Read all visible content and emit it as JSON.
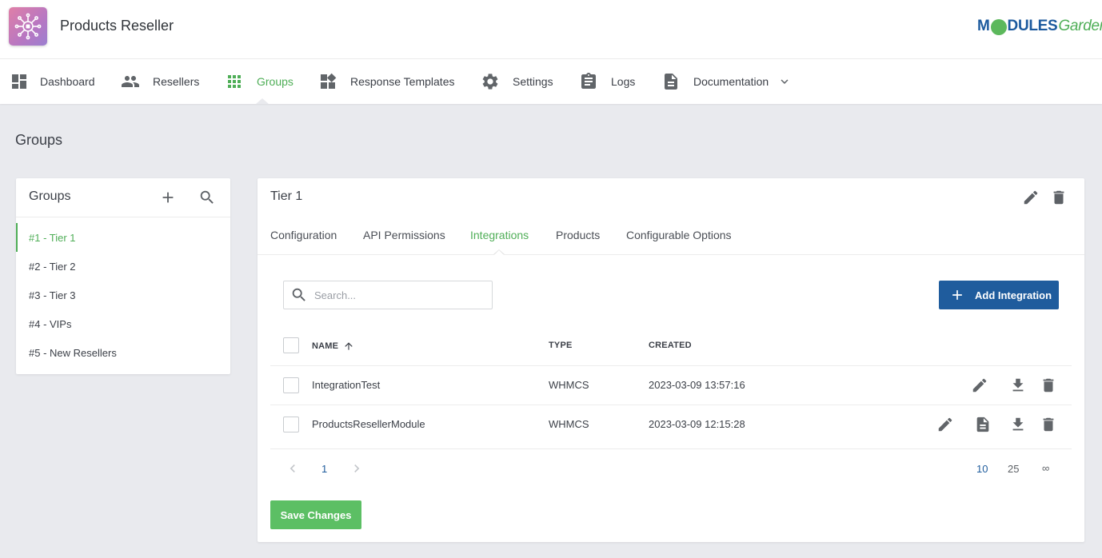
{
  "header": {
    "app_title": "Products Reseller",
    "brand_modules": "M",
    "brand_dules": "DULES",
    "brand_garden": "Garden",
    "accent_green": "#4fae57",
    "accent_blue": "#1f5c9d"
  },
  "nav": {
    "items": [
      {
        "label": "Dashboard",
        "icon": "dashboard-icon"
      },
      {
        "label": "Resellers",
        "icon": "people-icon"
      },
      {
        "label": "Groups",
        "icon": "grid-icon",
        "active": true
      },
      {
        "label": "Response Templates",
        "icon": "widgets-icon"
      },
      {
        "label": "Settings",
        "icon": "gear-icon"
      },
      {
        "label": "Logs",
        "icon": "clipboard-icon"
      },
      {
        "label": "Documentation",
        "icon": "document-icon"
      }
    ]
  },
  "page": {
    "title": "Groups"
  },
  "groups_panel": {
    "title": "Groups",
    "items": [
      "#1 - Tier 1",
      "#2 - Tier 2",
      "#3 - Tier 3",
      "#4 - VIPs",
      "#5 - New Resellers"
    ],
    "selected_index": 0
  },
  "detail": {
    "title": "Tier 1",
    "tabs": [
      "Configuration",
      "API Permissions",
      "Integrations",
      "Products",
      "Configurable Options"
    ],
    "active_tab": "Integrations",
    "search": {
      "placeholder": "Search..."
    },
    "add_button": "Add Integration",
    "table": {
      "headers": {
        "name": "NAME",
        "type": "TYPE",
        "created": "CREATED"
      },
      "sort": "name-ascending",
      "rows": [
        {
          "name": "IntegrationTest",
          "type": "WHMCS",
          "created": "2023-03-09 13:57:16"
        },
        {
          "name": "ProductsResellerModule",
          "type": "WHMCS",
          "created": "2023-03-09 12:15:28"
        }
      ]
    },
    "pagination": {
      "current_page": "1",
      "page_sizes": [
        "10",
        "25",
        "∞"
      ],
      "selected_size": "10"
    },
    "save_button": "Save Changes"
  }
}
